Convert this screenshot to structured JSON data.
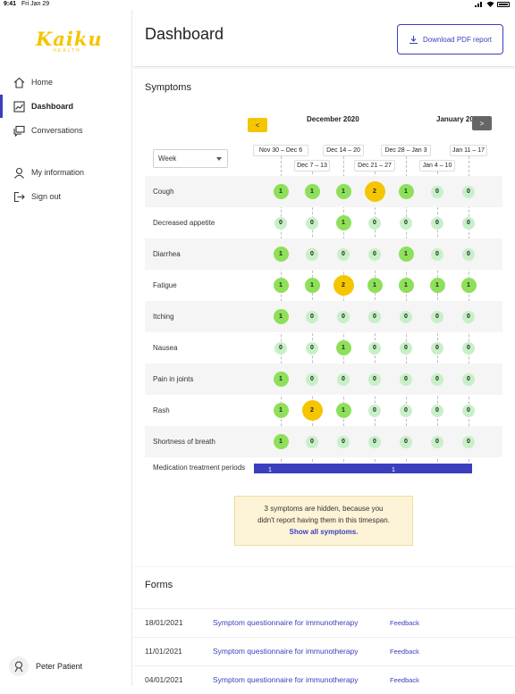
{
  "status_bar": {
    "time": "9:41",
    "date": "Fri Jan 29"
  },
  "brand": {
    "name": "Kaiku",
    "sub": "HEALTH",
    "color": "#f5c500"
  },
  "sidebar": {
    "items": [
      {
        "label": "Home",
        "icon": "home-icon"
      },
      {
        "label": "Dashboard",
        "icon": "chart-icon",
        "active": true
      },
      {
        "label": "Conversations",
        "icon": "chat-icon"
      },
      {
        "label": "My information",
        "icon": "person-icon"
      },
      {
        "label": "Sign out",
        "icon": "sign-out-icon"
      }
    ],
    "user": "Peter Patient"
  },
  "header": {
    "title": "Dashboard",
    "pdf_button": "Download PDF report"
  },
  "symptoms": {
    "title": "Symptoms",
    "prev": "<",
    "next": ">",
    "months": [
      "December 2020",
      "January 20"
    ],
    "period_select": "Week",
    "weeks": [
      "Nov 30 – Dec 6",
      "Dec 7 – 13",
      "Dec 14 – 20",
      "Dec 21 – 27",
      "Dec 28 – Jan 3",
      "Jan 4 – 10",
      "Jan 11 – 17"
    ],
    "rows": [
      {
        "name": "Cough",
        "values": [
          1,
          1,
          1,
          2,
          1,
          0,
          0
        ]
      },
      {
        "name": "Decreased appetite",
        "values": [
          0,
          0,
          1,
          0,
          0,
          0,
          0
        ]
      },
      {
        "name": "Diarrhea",
        "values": [
          1,
          0,
          0,
          0,
          1,
          0,
          0
        ]
      },
      {
        "name": "Fatigue",
        "values": [
          1,
          1,
          2,
          1,
          1,
          1,
          1
        ]
      },
      {
        "name": "Itching",
        "values": [
          1,
          0,
          0,
          0,
          0,
          0,
          0
        ]
      },
      {
        "name": "Nausea",
        "values": [
          0,
          0,
          1,
          0,
          0,
          0,
          0
        ]
      },
      {
        "name": "Pain in joints",
        "values": [
          1,
          0,
          0,
          0,
          0,
          0,
          0
        ]
      },
      {
        "name": "Rash",
        "values": [
          1,
          2,
          1,
          0,
          0,
          0,
          0
        ]
      },
      {
        "name": "Shortness of breath",
        "values": [
          1,
          0,
          0,
          0,
          0,
          0,
          0
        ]
      }
    ],
    "medication": {
      "label": "Medication treatment periods",
      "values": [
        "1",
        "1"
      ],
      "color": "#3b3fbd"
    },
    "notice": {
      "line1": "3 symptoms are hidden, because you",
      "line2": "didn't report having them in this timespan.",
      "link": "Show all symptoms."
    }
  },
  "forms": {
    "title": "Forms",
    "rows": [
      {
        "date": "18/01/2021",
        "name": "Symptom questionnaire for immunotherapy",
        "feedback": "Feedback"
      },
      {
        "date": "11/01/2021",
        "name": "Symptom questionnaire for immunotherapy",
        "feedback": "Feedback"
      },
      {
        "date": "04/01/2021",
        "name": "Symptom questionnaire for immunotherapy",
        "feedback": "Feedback"
      }
    ]
  },
  "colors": {
    "accent": "#3b3fbd",
    "level0": "#c8f0c8",
    "level1": "#8ee05a",
    "level2": "#f5c500"
  }
}
